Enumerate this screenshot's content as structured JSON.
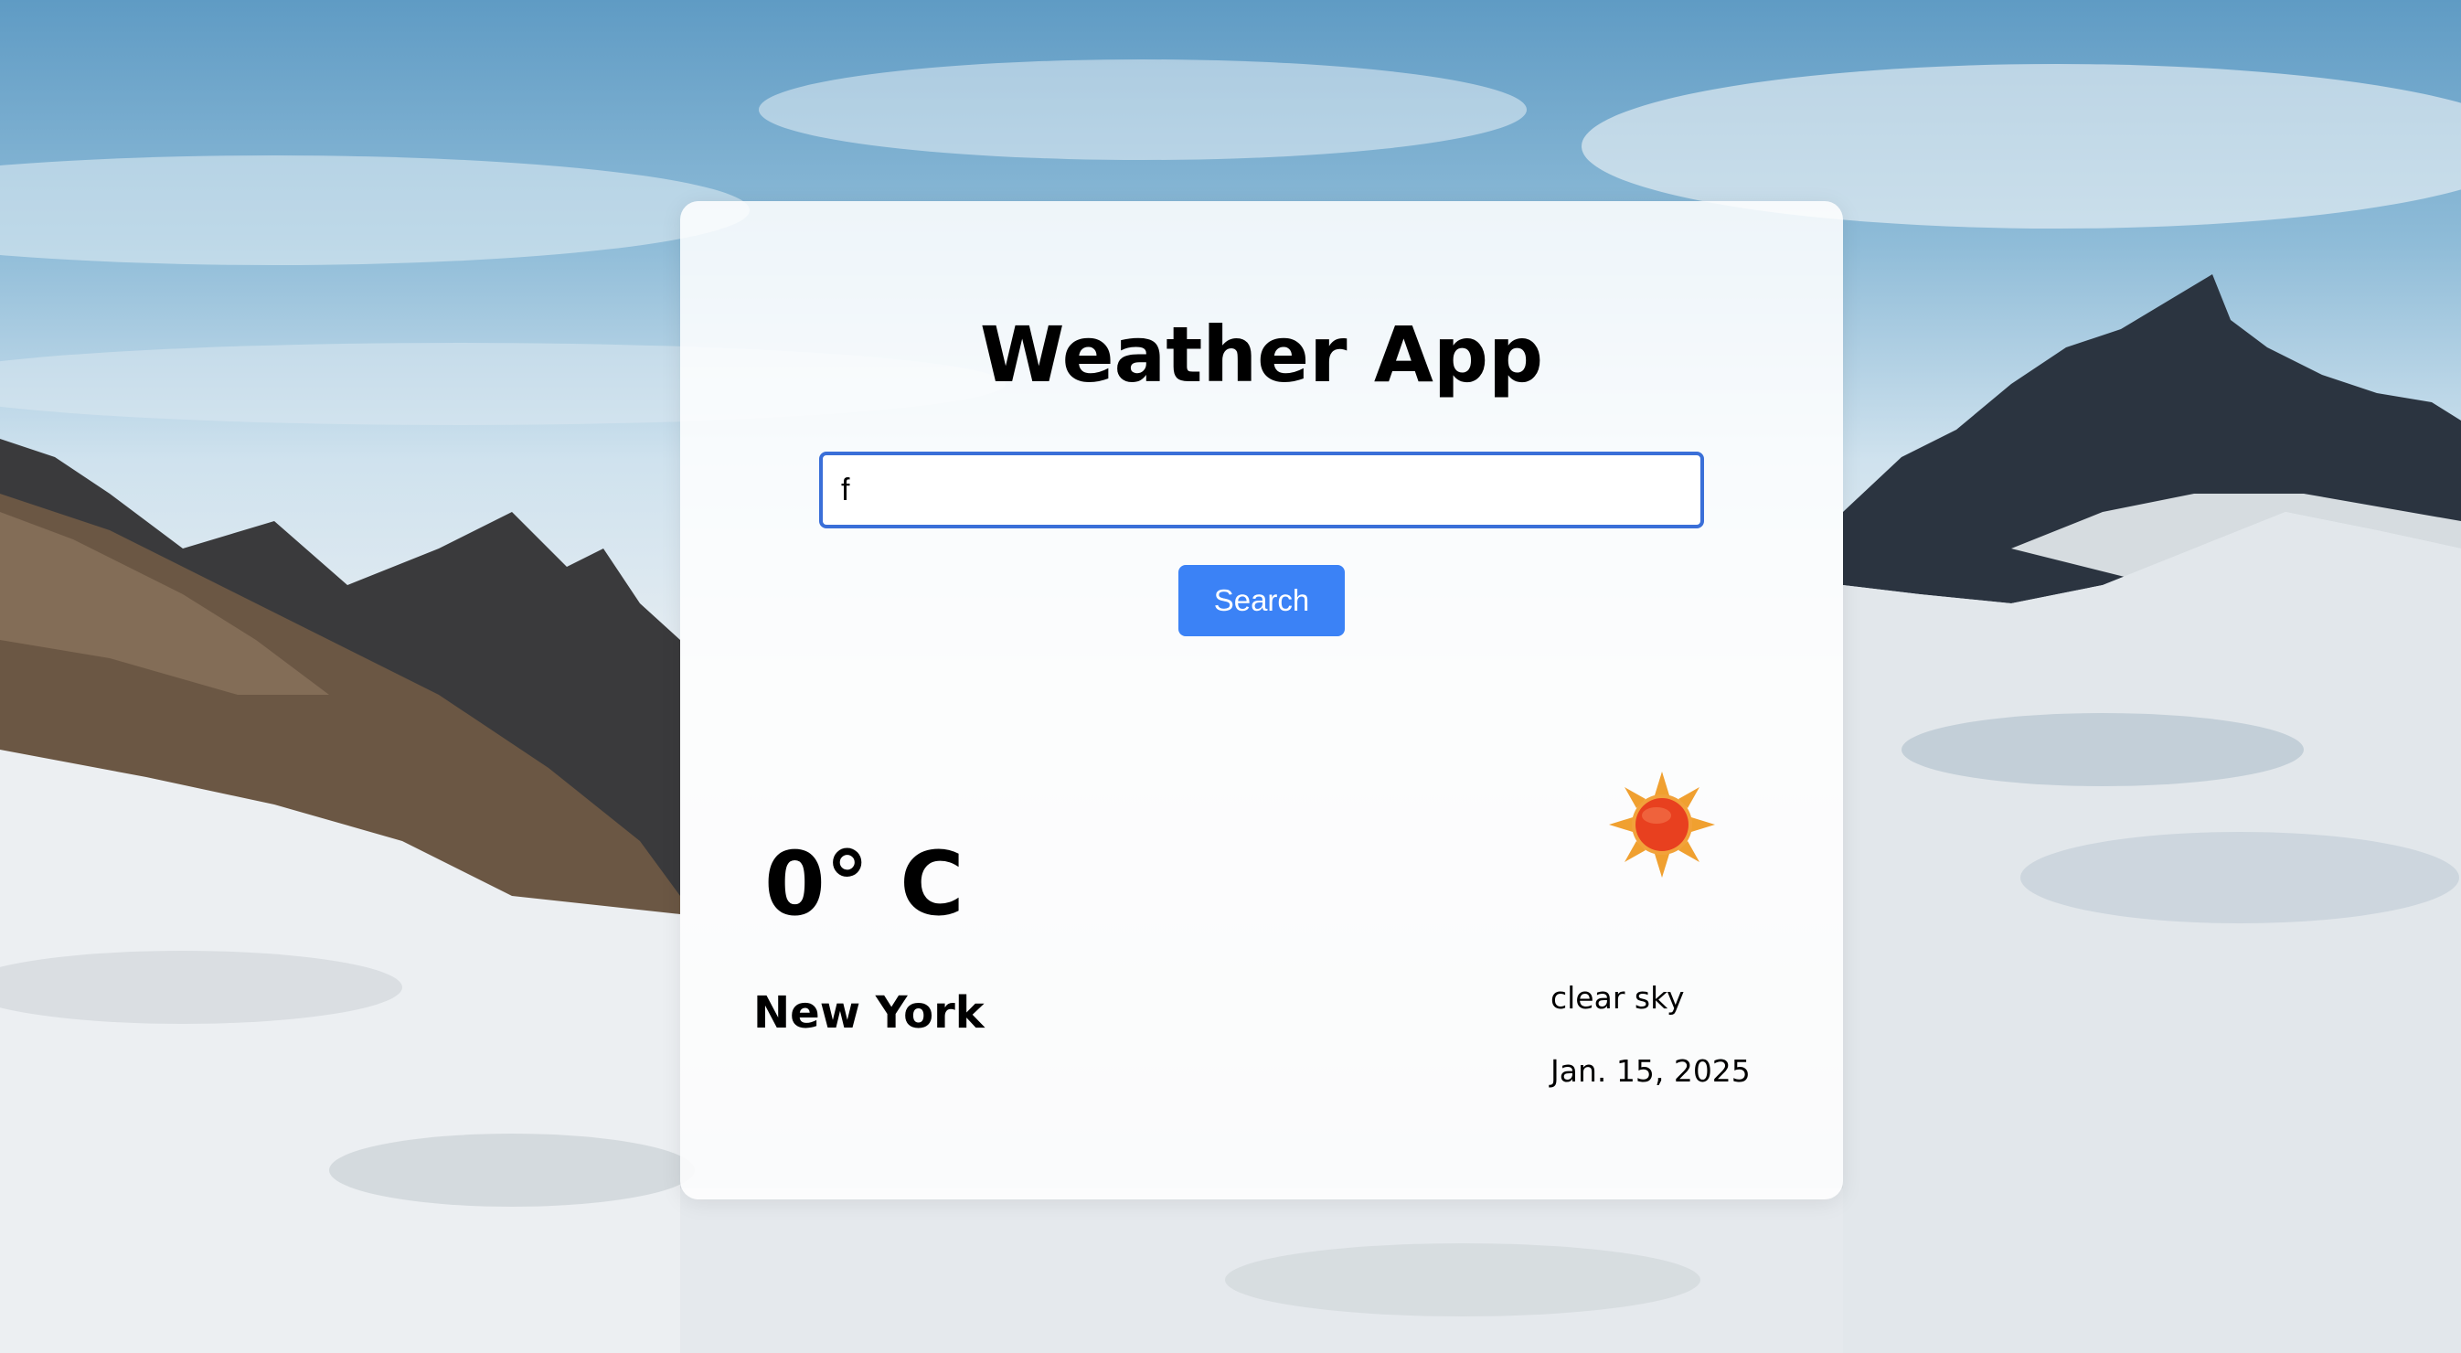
{
  "app": {
    "title": "Weather App"
  },
  "search": {
    "value": "f",
    "button_label": "Search"
  },
  "weather": {
    "temperature": "0° C",
    "city": "New York",
    "description": "clear sky",
    "date": "Jan. 15, 2025",
    "icon": "sun-icon"
  },
  "colors": {
    "accent": "#3b82f6",
    "input_border": "#3a6fd8",
    "sun_core": "#e8401f",
    "sun_rays": "#f0a030"
  }
}
